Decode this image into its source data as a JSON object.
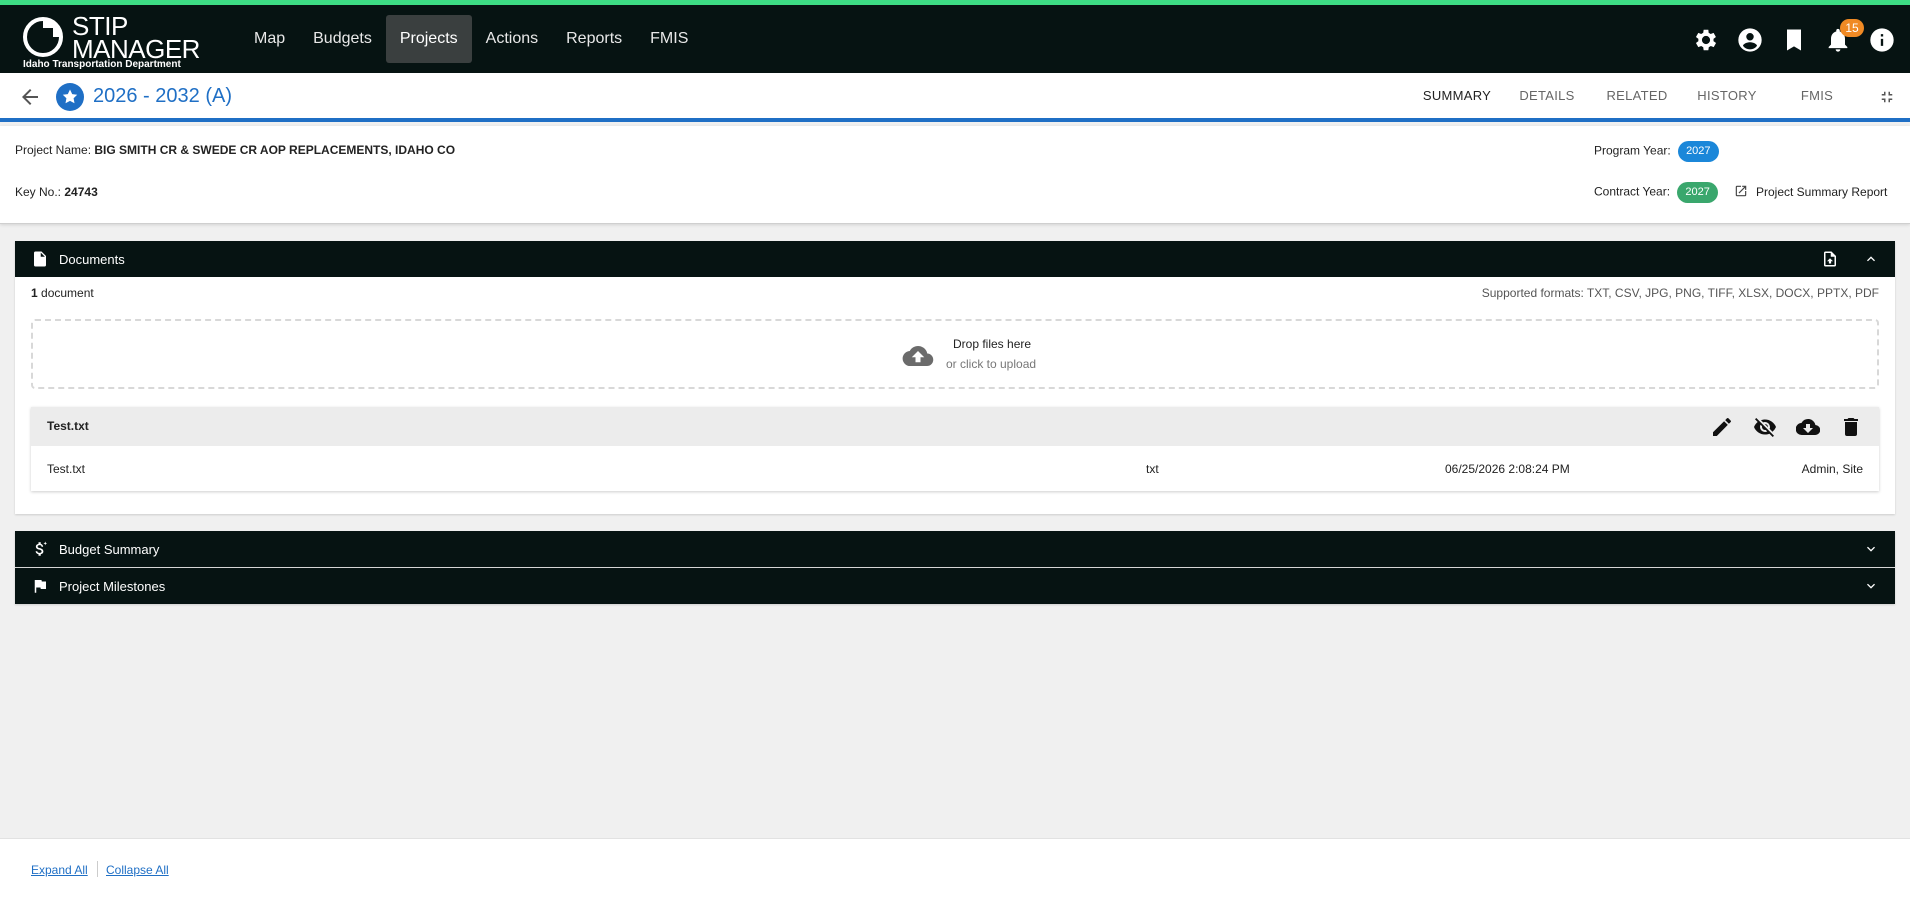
{
  "app": {
    "name_line1": "STIP",
    "name_line2": "MANAGER",
    "subtitle": "Idaho Transportation Department",
    "accent_color": "#3ddc84",
    "brand_blue": "#1f6fc5"
  },
  "nav": {
    "items": [
      {
        "label": "Map"
      },
      {
        "label": "Budgets"
      },
      {
        "label": "Projects",
        "active": true
      },
      {
        "label": "Actions"
      },
      {
        "label": "Reports"
      },
      {
        "label": "FMIS"
      }
    ],
    "icons": [
      "gear-icon",
      "account-icon",
      "bookmark-icon",
      "bell-icon",
      "info-icon"
    ],
    "notification_count": "15"
  },
  "project": {
    "title": "2026 - 2032 (A)",
    "tabs": [
      {
        "label": "SUMMARY",
        "active": true
      },
      {
        "label": "DETAILS"
      },
      {
        "label": "RELATED"
      },
      {
        "label": "HISTORY"
      },
      {
        "label": "FMIS"
      }
    ],
    "name_label": "Project Name:",
    "name_value": "BIG SMITH CR & SWEDE CR AOP REPLACEMENTS, IDAHO CO",
    "key_label": "Key No.:",
    "key_value": "24743",
    "program_year_label": "Program Year:",
    "program_year_value": "2027",
    "contract_year_label": "Contract Year:",
    "contract_year_value": "2027",
    "summary_report_label": "Project Summary Report"
  },
  "documents": {
    "title": "Documents",
    "count": "1",
    "count_suffix": "document",
    "supported_formats": "Supported formats: TXT, CSV, JPG, PNG, TIFF, XLSX, DOCX, PPTX, PDF",
    "drop_text": "Drop files here",
    "click_text": "or click to upload",
    "files": [
      {
        "title": "Test.txt",
        "name": "Test.txt",
        "type": "txt",
        "date": "06/25/2026 2:08:24 PM",
        "owner": "Admin, Site"
      }
    ]
  },
  "sections": {
    "budget_summary": "Budget Summary",
    "project_milestones": "Project Milestones"
  },
  "footer": {
    "expand_all": "Expand All",
    "collapse_all": "Collapse All"
  }
}
